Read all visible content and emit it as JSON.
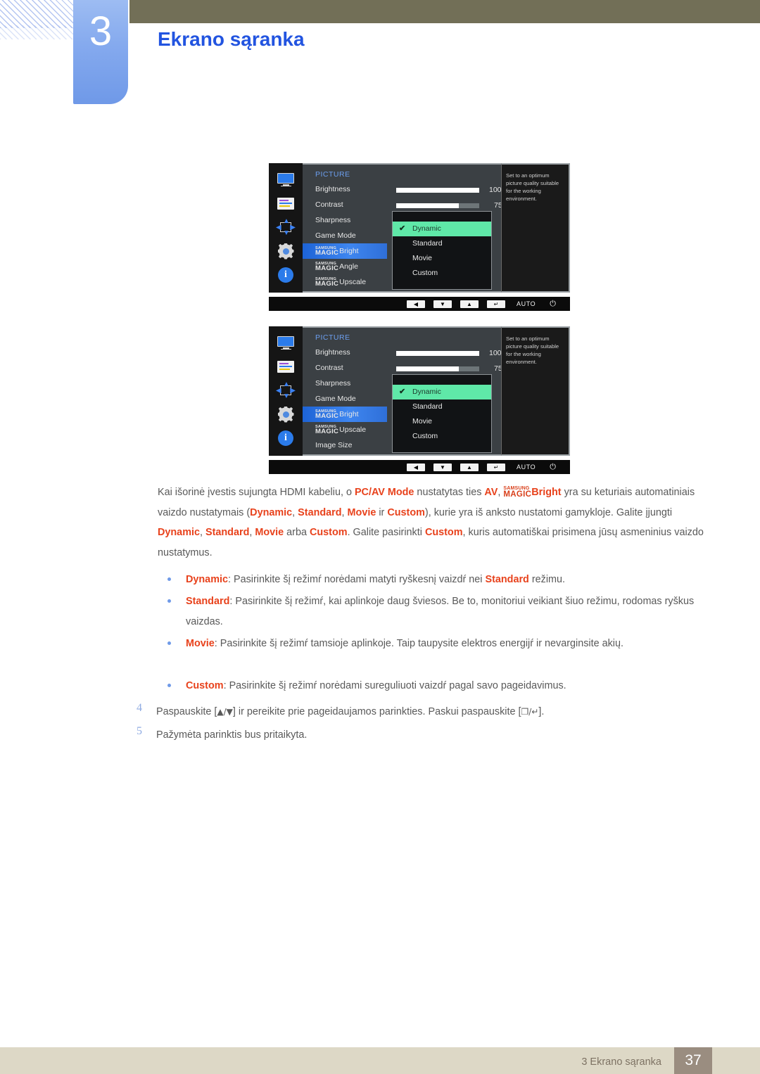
{
  "header": {
    "chapter_number": "3",
    "chapter_title": "Ekrano sąranka"
  },
  "osd_panels": [
    {
      "id": "osd-top",
      "category": "PICTURE",
      "icons": [
        "monitor-icon",
        "osd-display-icon",
        "position-arrows-icon",
        "gear-icon",
        "info-icon"
      ],
      "menu_items": [
        {
          "label": "Brightness",
          "type": "slider",
          "value": "100",
          "fill_pct": 100
        },
        {
          "label": "Contrast",
          "type": "slider",
          "value": "75",
          "fill_pct": 75
        },
        {
          "label": "Sharpness",
          "type": "plain"
        },
        {
          "label": "Game Mode",
          "type": "plain"
        },
        {
          "label": "Bright",
          "type": "magic",
          "brand_top": "SAMSUNG",
          "brand_bottom": "MAGIC",
          "selected": true
        },
        {
          "label": "Angle",
          "type": "magic",
          "brand_top": "SAMSUNG",
          "brand_bottom": "MAGIC",
          "selected": false
        },
        {
          "label": "Upscale",
          "type": "magic",
          "brand_top": "SAMSUNG",
          "brand_bottom": "MAGIC",
          "selected": false
        }
      ],
      "dropdown": {
        "options": [
          "Dynamic",
          "Standard",
          "Movie",
          "Custom"
        ],
        "checked": "Dynamic",
        "check_glyph": "✔"
      },
      "help_text": "Set to an optimum picture quality suitable for the working environment.",
      "control_bar": {
        "buttons": [
          "◀",
          "▼",
          "▲",
          "↵"
        ],
        "auto_label": "AUTO",
        "power_glyph": "⏻"
      }
    },
    {
      "id": "osd-bottom",
      "category": "PICTURE",
      "icons": [
        "monitor-icon",
        "osd-display-icon",
        "position-arrows-icon",
        "gear-icon",
        "info-icon"
      ],
      "menu_items": [
        {
          "label": "Brightness",
          "type": "slider",
          "value": "100",
          "fill_pct": 100
        },
        {
          "label": "Contrast",
          "type": "slider",
          "value": "75",
          "fill_pct": 75
        },
        {
          "label": "Sharpness",
          "type": "plain"
        },
        {
          "label": "Game Mode",
          "type": "plain"
        },
        {
          "label": "Bright",
          "type": "magic",
          "brand_top": "SAMSUNG",
          "brand_bottom": "MAGIC",
          "selected": true
        },
        {
          "label": "Upscale",
          "type": "magic",
          "brand_top": "SAMSUNG",
          "brand_bottom": "MAGIC",
          "selected": false
        },
        {
          "label": "Image Size",
          "type": "plain"
        }
      ],
      "dropdown": {
        "options": [
          "Dynamic",
          "Standard",
          "Movie",
          "Custom"
        ],
        "checked": "Dynamic",
        "check_glyph": "✔"
      },
      "help_text": "Set to an optimum picture quality suitable for the working environment.",
      "control_bar": {
        "buttons": [
          "◀",
          "▼",
          "▲",
          "↵"
        ],
        "auto_label": "AUTO",
        "power_glyph": "⏻"
      }
    }
  ],
  "body": {
    "intro": {
      "p1_a": "Kai išorinė įvestis sujungta HDMI kabeliu, o ",
      "p1_pcav": "PC/AV Mode",
      "p1_b": " nustatytas ties ",
      "p1_av": "AV",
      "p1_c": ", ",
      "p1_magic_top": "SAMSUNG",
      "p1_magic_bottom": "MAGIC",
      "p1_bright": "Bright",
      "p1_d": " yra su keturiais automatiniais vaizdo nustatymais (",
      "p1_dynamic": "Dynamic",
      "p1_e": ", ",
      "p1_standard": "Standard",
      "p1_f": ", ",
      "p1_movie": "Movie",
      "p1_g": " ir ",
      "p1_custom": "Custom",
      "p1_h": "), kurie yra iš anksto nustatomi gamykloje. Galite įjungti ",
      "p1_dynamic2": "Dynamic",
      "p1_i": ", ",
      "p1_standard2": "Standard",
      "p1_j": ", ",
      "p1_movie2": "Movie",
      "p1_k": " arba ",
      "p1_custom2": "Custom",
      "p1_l": ". Galite pasirinkti ",
      "p1_custom3": "Custom",
      "p1_m": ", kuris automatiškai prisimena jūsų asmeninius vaizdo nustatymus."
    },
    "bullets": [
      {
        "term": "Dynamic",
        "text_a": ": Pasirinkite šį režimŕ norėdami matyti ryškesnį vaizdŕ nei ",
        "term2": "Standard",
        "text_b": " režimu."
      },
      {
        "term": "Standard",
        "text_a": ": Pasirinkite šį režimŕ, kai aplinkoje daug šviesos. Be to, monitoriui veikiant šiuo režimu, rodomas ryškus vaizdas.",
        "term2": "",
        "text_b": ""
      },
      {
        "term": "Movie",
        "text_a": ": Pasirinkite šį režimŕ tamsioje aplinkoje. Taip taupysite elektros energijŕ ir nevarginsite akių.",
        "term2": "",
        "text_b": ""
      },
      {
        "term": "Custom",
        "text_a": ": Pasirinkite šį režimŕ norėdami sureguliuoti vaizdŕ pagal savo pageidavimus.",
        "term2": "",
        "text_b": ""
      }
    ],
    "steps": [
      {
        "number": "4",
        "text_a": "Paspauskite [",
        "keys_a": "▲/▼",
        "text_b": "] ir pereikite prie pageidaujamos parinkties. Paskui paspauskite [",
        "keys_b": "❐/↵",
        "text_c": "]."
      },
      {
        "number": "5",
        "text_a": "Pažymėta parinktis bus pritaikyta.",
        "keys_a": "",
        "text_b": "",
        "keys_b": "",
        "text_c": ""
      }
    ]
  },
  "footer": {
    "label": "3 Ekrano sąranka",
    "page_number": "37"
  },
  "colors": {
    "accent_blue": "#2254e0",
    "highlight_red": "#e8421c",
    "osd_select_blue": "#2f6fd8",
    "osd_active_green": "#5fe8a8",
    "header_olive": "#726f57",
    "footer_beige": "#ddd8c6",
    "footer_page_brown": "#9a8d80"
  }
}
